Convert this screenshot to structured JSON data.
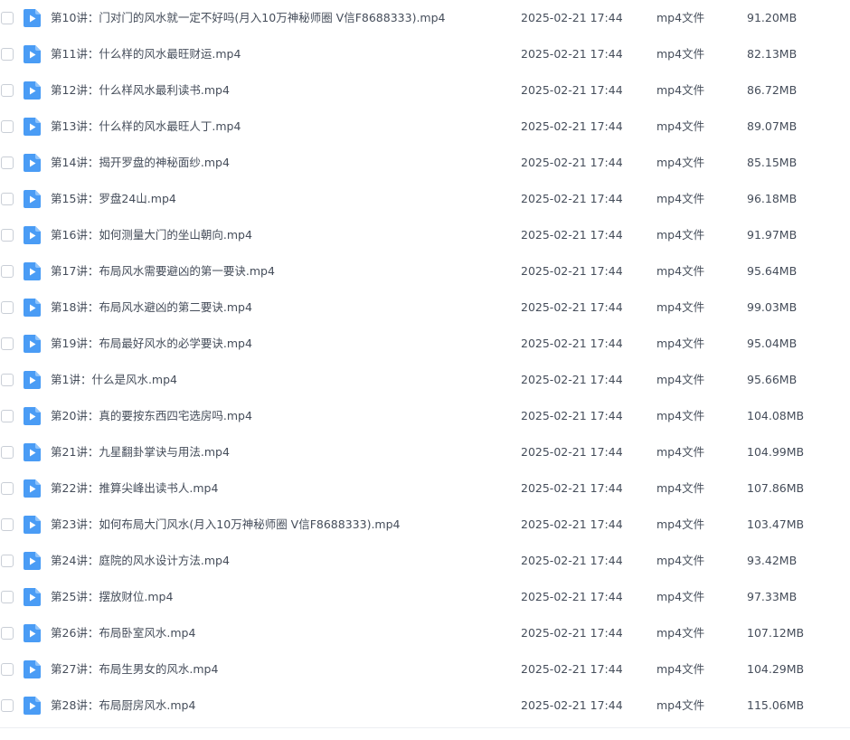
{
  "files": [
    {
      "name": "第10讲：门对门的风水就一定不好吗(月入10万神秘师圈 V信F8688333).mp4",
      "date": "2025-02-21 17:44",
      "type": "mp4文件",
      "size": "91.20MB"
    },
    {
      "name": "第11讲：什么样的风水最旺财运.mp4",
      "date": "2025-02-21 17:44",
      "type": "mp4文件",
      "size": "82.13MB"
    },
    {
      "name": "第12讲：什么样风水最利读书.mp4",
      "date": "2025-02-21 17:44",
      "type": "mp4文件",
      "size": "86.72MB"
    },
    {
      "name": "第13讲：什么样的风水最旺人丁.mp4",
      "date": "2025-02-21 17:44",
      "type": "mp4文件",
      "size": "89.07MB"
    },
    {
      "name": "第14讲：揭开罗盘的神秘面纱.mp4",
      "date": "2025-02-21 17:44",
      "type": "mp4文件",
      "size": "85.15MB"
    },
    {
      "name": "第15讲：罗盘24山.mp4",
      "date": "2025-02-21 17:44",
      "type": "mp4文件",
      "size": "96.18MB"
    },
    {
      "name": "第16讲：如何测量大门的坐山朝向.mp4",
      "date": "2025-02-21 17:44",
      "type": "mp4文件",
      "size": "91.97MB"
    },
    {
      "name": "第17讲：布局风水需要避凶的第一要诀.mp4",
      "date": "2025-02-21 17:44",
      "type": "mp4文件",
      "size": "95.64MB"
    },
    {
      "name": "第18讲：布局风水避凶的第二要诀.mp4",
      "date": "2025-02-21 17:44",
      "type": "mp4文件",
      "size": "99.03MB"
    },
    {
      "name": "第19讲：布局最好风水的必学要诀.mp4",
      "date": "2025-02-21 17:44",
      "type": "mp4文件",
      "size": "95.04MB"
    },
    {
      "name": "第1讲：什么是风水.mp4",
      "date": "2025-02-21 17:44",
      "type": "mp4文件",
      "size": "95.66MB"
    },
    {
      "name": "第20讲：真的要按东西四宅选房吗.mp4",
      "date": "2025-02-21 17:44",
      "type": "mp4文件",
      "size": "104.08MB"
    },
    {
      "name": "第21讲：九星翻卦掌诀与用法.mp4",
      "date": "2025-02-21 17:44",
      "type": "mp4文件",
      "size": "104.99MB"
    },
    {
      "name": "第22讲：推算尖峰出读书人.mp4",
      "date": "2025-02-21 17:44",
      "type": "mp4文件",
      "size": "107.86MB"
    },
    {
      "name": "第23讲：如何布局大门风水(月入10万神秘师圈 V信F8688333).mp4",
      "date": "2025-02-21 17:44",
      "type": "mp4文件",
      "size": "103.47MB"
    },
    {
      "name": "第24讲：庭院的风水设计方法.mp4",
      "date": "2025-02-21 17:44",
      "type": "mp4文件",
      "size": "93.42MB"
    },
    {
      "name": "第25讲：摆放财位.mp4",
      "date": "2025-02-21 17:44",
      "type": "mp4文件",
      "size": "97.33MB"
    },
    {
      "name": "第26讲：布局卧室风水.mp4",
      "date": "2025-02-21 17:44",
      "type": "mp4文件",
      "size": "107.12MB"
    },
    {
      "name": "第27讲：布局生男女的风水.mp4",
      "date": "2025-02-21 17:44",
      "type": "mp4文件",
      "size": "104.29MB"
    },
    {
      "name": "第28讲：布局厨房风水.mp4",
      "date": "2025-02-21 17:44",
      "type": "mp4文件",
      "size": "115.06MB"
    }
  ],
  "icon": {
    "name": "video-file-icon",
    "color": "#4a9cf5"
  }
}
